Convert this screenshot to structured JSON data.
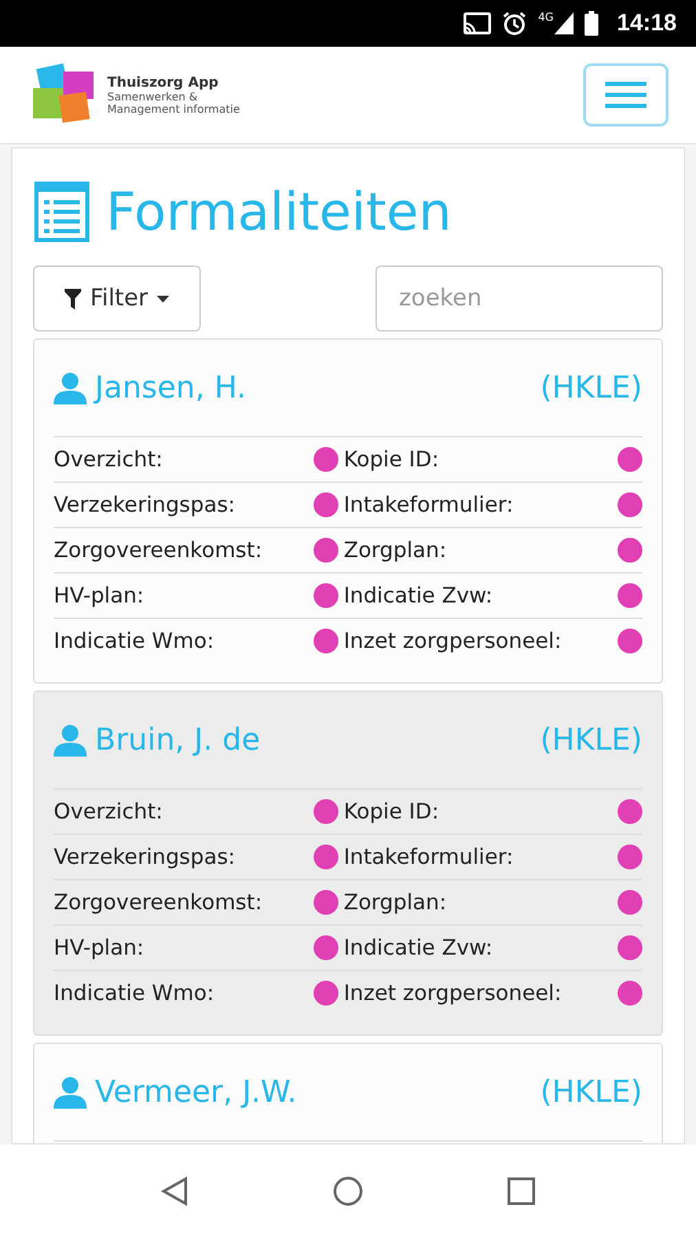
{
  "status_bar": {
    "time": "14:18",
    "network": "4G"
  },
  "header": {
    "app_name": "Thuiszorg App",
    "tagline_1": "Samenwerken &",
    "tagline_2": "Management informatie"
  },
  "page": {
    "title": "Formaliteiten",
    "filter_label": "Filter",
    "search": {
      "placeholder": "zoeken"
    }
  },
  "clients": [
    {
      "name": "Jansen, H.",
      "tag": "(HKLE)",
      "selected": false,
      "items": [
        [
          "Overzicht:",
          "Kopie ID:"
        ],
        [
          "Verzekeringspas:",
          "Intakeformulier:"
        ],
        [
          "Zorgovereenkomst:",
          "Zorgplan:"
        ],
        [
          "HV-plan:",
          "Indicatie Zvw:"
        ],
        [
          "Indicatie Wmo:",
          "Inzet zorgpersoneel:"
        ]
      ]
    },
    {
      "name": "Bruin, J. de",
      "tag": "(HKLE)",
      "selected": true,
      "items": [
        [
          "Overzicht:",
          "Kopie ID:"
        ],
        [
          "Verzekeringspas:",
          "Intakeformulier:"
        ],
        [
          "Zorgovereenkomst:",
          "Zorgplan:"
        ],
        [
          "HV-plan:",
          "Indicatie Zvw:"
        ],
        [
          "Indicatie Wmo:",
          "Inzet zorgpersoneel:"
        ]
      ]
    },
    {
      "name": "Vermeer, J.W.",
      "tag": "(HKLE)",
      "selected": false
    }
  ]
}
